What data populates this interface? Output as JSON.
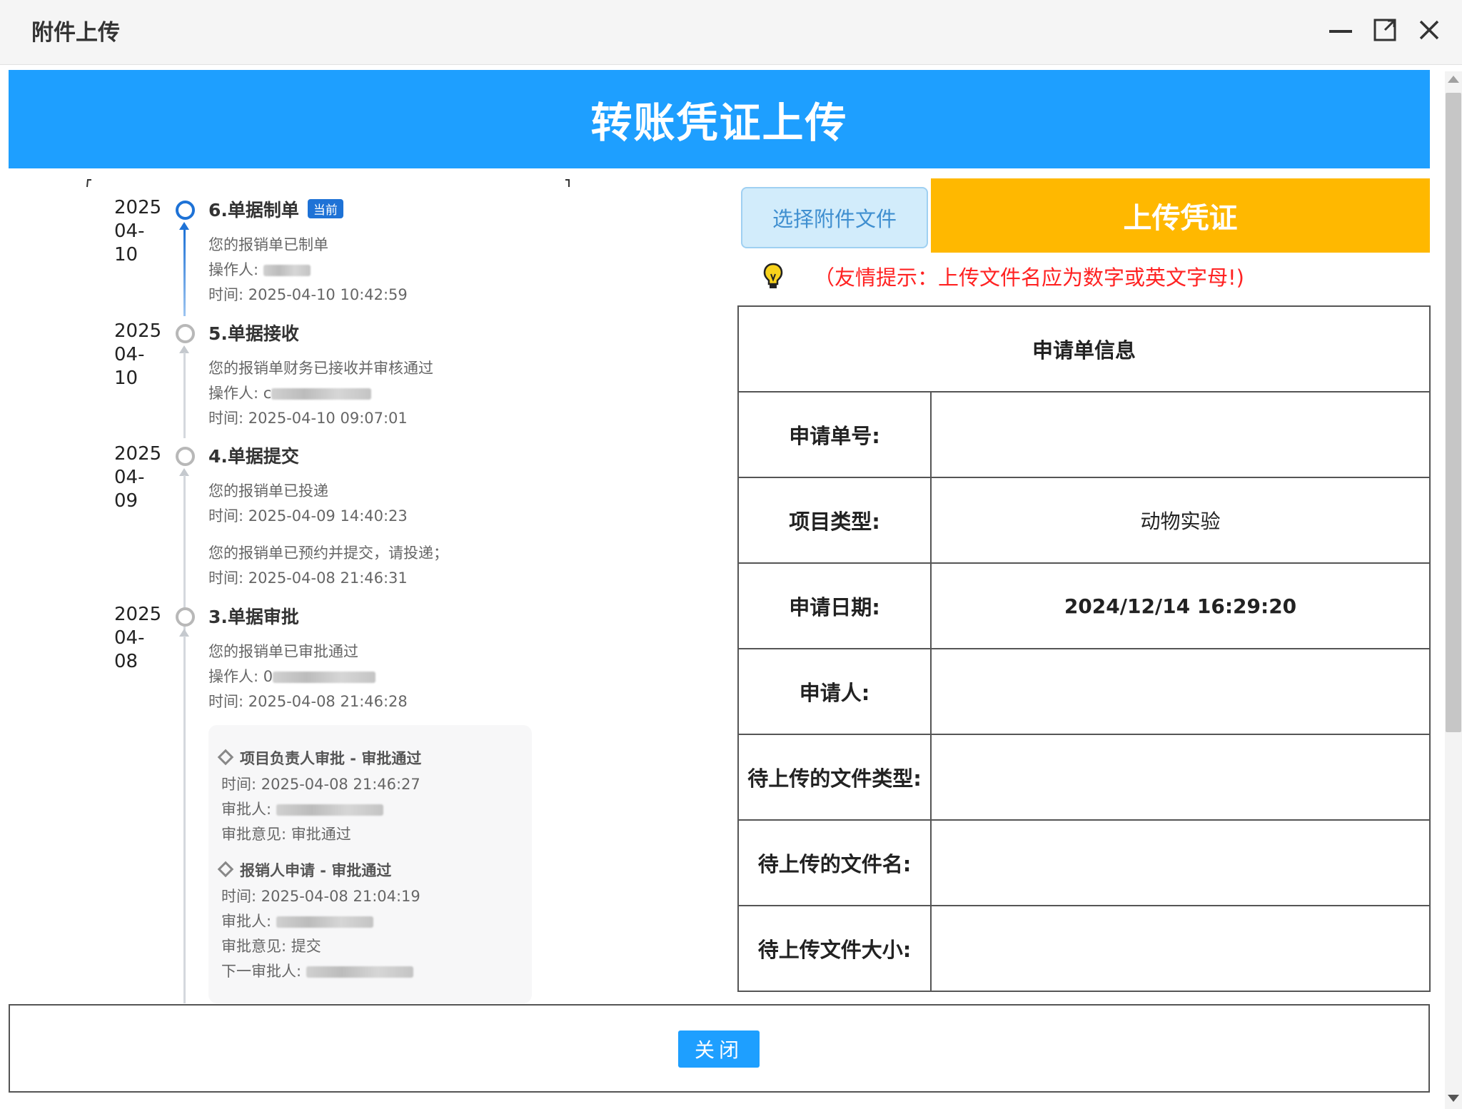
{
  "window": {
    "title": "附件上传"
  },
  "banner": {
    "title": "转账凭证上传"
  },
  "timeline": [
    {
      "date": "2025\n04-\n10",
      "title": "6.单据制单",
      "tag": "当前",
      "lines": [
        "您的报销单已制单",
        "操作人:",
        "时间: 2025-04-10 10:42:59"
      ]
    },
    {
      "date": "2025\n04-\n10",
      "title": "5.单据接收",
      "lines": [
        "您的报销单财务已接收并审核通过",
        "操作人: c",
        "时间: 2025-04-10 09:07:01"
      ]
    },
    {
      "date": "2025\n04-\n09",
      "title": "4.单据提交",
      "lines": [
        "您的报销单已投递",
        "时间: 2025-04-09 14:40:23",
        "您的报销单已预约并提交，请投递；",
        "时间: 2025-04-08 21:46:31"
      ]
    },
    {
      "date": "2025\n04-\n08",
      "title": "3.单据审批",
      "lines": [
        "您的报销单已审批通过",
        "操作人: 0",
        "时间: 2025-04-08 21:46:28"
      ]
    }
  ],
  "approvals": [
    {
      "title": "项目负责人审批 - 审批通过",
      "lines": [
        "时间: 2025-04-08 21:46:27",
        "审批人:",
        "审批意见: 审批通过"
      ]
    },
    {
      "title": "报销人申请 - 审批通过",
      "lines": [
        "时间: 2025-04-08 21:04:19",
        "审批人:",
        "审批意见: 提交",
        "下一审批人:"
      ]
    }
  ],
  "actions": {
    "select_label": "选择附件文件",
    "upload_label": "上传凭证",
    "hint": "（友情提示：上传文件名应为数字或英文字母!)"
  },
  "info_table": {
    "header": "申请单信息",
    "rows": [
      {
        "label": "申请单号:",
        "value": ""
      },
      {
        "label": "项目类型:",
        "value": "动物实验"
      },
      {
        "label": "申请日期:",
        "value": "2024/12/14 16:29:20"
      },
      {
        "label": "申请人:",
        "value": ""
      },
      {
        "label": "待上传的文件类型:",
        "value": ""
      },
      {
        "label": "待上传的文件名:",
        "value": ""
      },
      {
        "label": "待上传文件大小:",
        "value": ""
      }
    ]
  },
  "footer": {
    "close_label": "关闭"
  },
  "colors": {
    "primary": "#1e9fff",
    "upload": "#ffb800",
    "hint": "#ff2222",
    "timeline_current": "#1e72d6"
  }
}
